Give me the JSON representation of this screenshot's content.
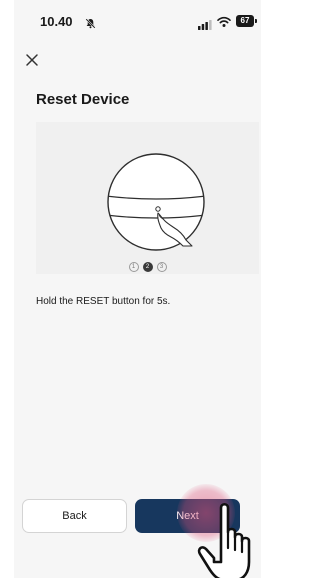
{
  "status_bar": {
    "time": "10.40",
    "battery": "67",
    "icons": [
      "bell-muted-icon",
      "signal-icon",
      "wifi-icon",
      "battery-icon"
    ]
  },
  "header": {
    "close_icon": "close-icon",
    "title": "Reset Device"
  },
  "illustration": {
    "steps": [
      {
        "label": "1",
        "active": false
      },
      {
        "label": "2",
        "active": true
      },
      {
        "label": "3",
        "active": false
      }
    ]
  },
  "instruction": "Hold the RESET button for 5s.",
  "footer": {
    "back_label": "Back",
    "next_label": "Next"
  },
  "colors": {
    "primary": "#17375e",
    "background": "#f6f6f6",
    "tap_highlight": "#dc5078"
  }
}
